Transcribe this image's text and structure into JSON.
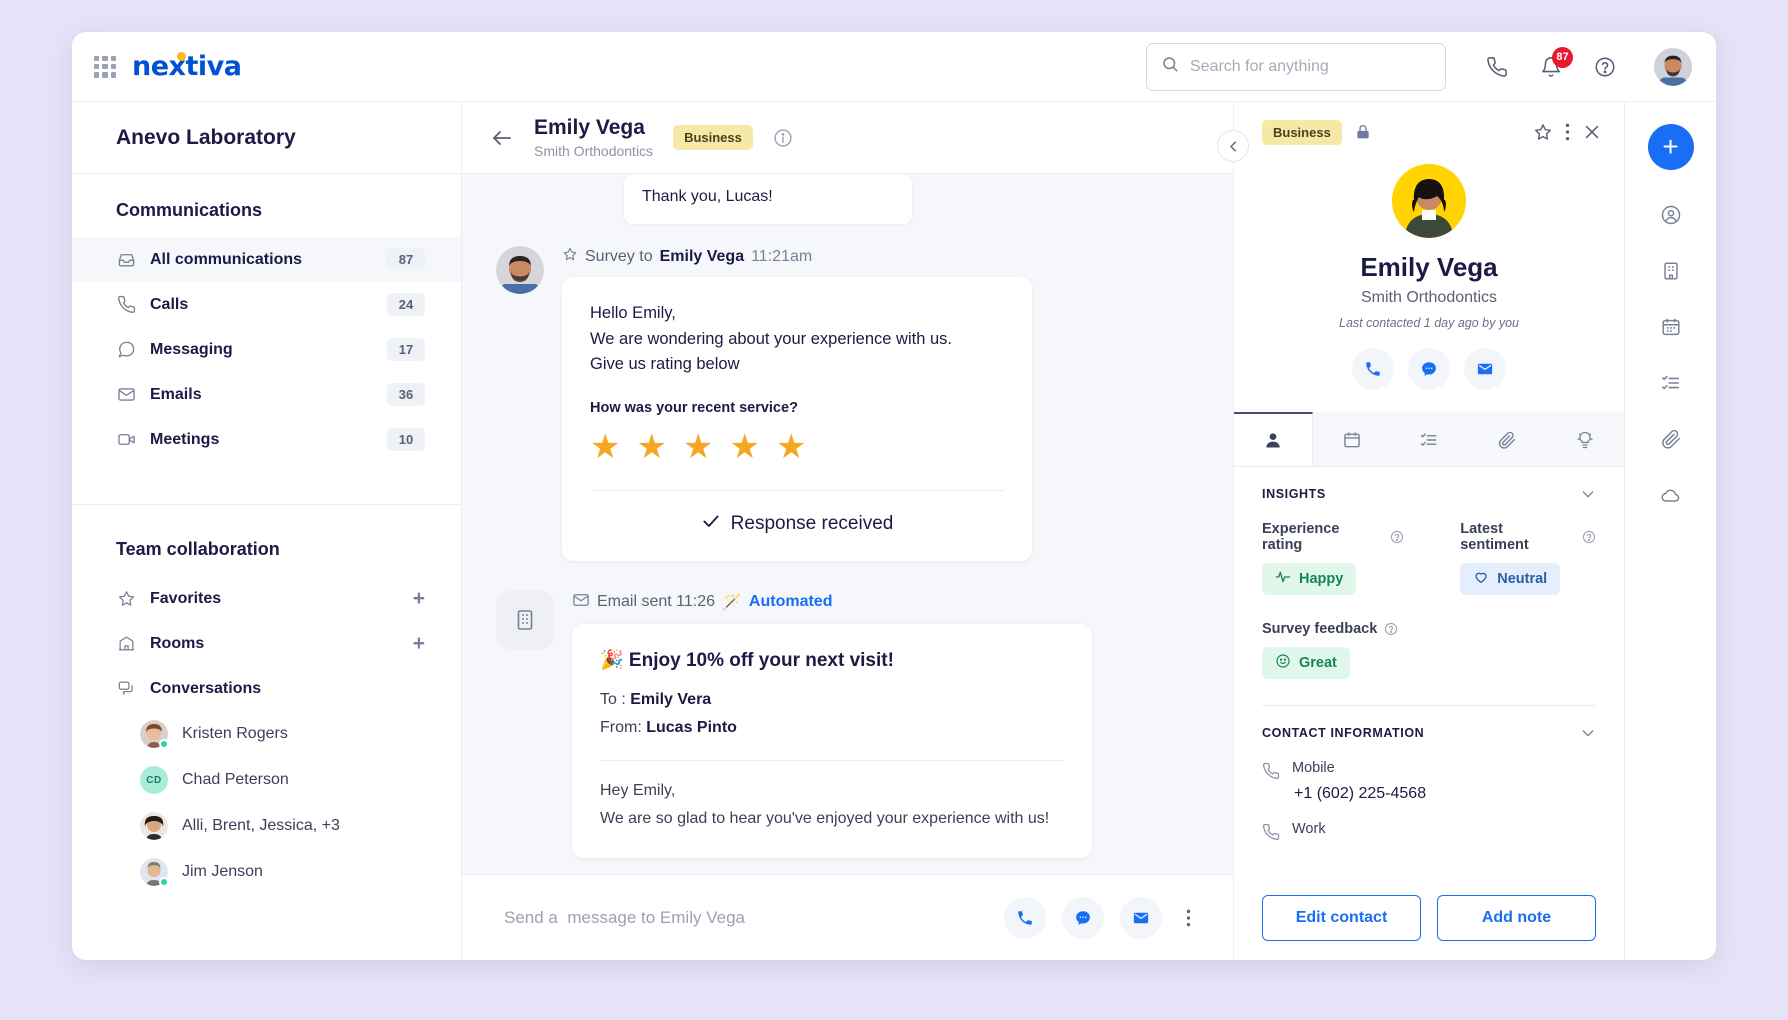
{
  "topbar": {
    "logo_text": "nextiva",
    "search_placeholder": "Search for anything",
    "notification_count": "87",
    "icons": [
      "grid-icon",
      "phone-icon",
      "bell-icon",
      "help-icon",
      "user-avatar"
    ]
  },
  "sidebar": {
    "workspace": "Anevo Laboratory",
    "communications_title": "Communications",
    "communications": [
      {
        "label": "All communications",
        "count": "87",
        "icon": "inbox-icon",
        "active": true
      },
      {
        "label": "Calls",
        "count": "24",
        "icon": "phone-icon",
        "active": false
      },
      {
        "label": "Messaging",
        "count": "17",
        "icon": "chat-icon",
        "active": false
      },
      {
        "label": "Emails",
        "count": "36",
        "icon": "envelope-icon",
        "active": false
      },
      {
        "label": "Meetings",
        "count": "10",
        "icon": "video-icon",
        "active": false
      }
    ],
    "team_title": "Team collaboration",
    "team": [
      {
        "label": "Favorites",
        "icon": "star-icon",
        "action": "+"
      },
      {
        "label": "Rooms",
        "icon": "building-icon",
        "action": "+"
      },
      {
        "label": "Conversations",
        "icon": "conversations-icon",
        "action": ""
      }
    ],
    "conversations": [
      {
        "name": "Kristen Rogers",
        "online": true,
        "type": "photo"
      },
      {
        "name": "Chad Peterson",
        "online": false,
        "type": "initials",
        "initials": "CD"
      },
      {
        "name": "Alli, Brent, Jessica, +3",
        "online": false,
        "type": "photo"
      },
      {
        "name": "Jim Jenson",
        "online": true,
        "type": "photo"
      }
    ]
  },
  "conversation": {
    "contact_name": "Emily Vega",
    "contact_org": "Smith Orthodontics",
    "tag": "Business",
    "previous_message": "Thank you, Lucas!",
    "survey": {
      "label": "Survey to",
      "recipient": "Emily Vega",
      "time": "11:21am",
      "greeting": "Hello Emily,",
      "line2": "We are wondering about your experience with us.",
      "line3": "Give us rating below",
      "question": "How was your recent service?",
      "stars_filled": 5,
      "response_status": "Response received"
    },
    "email": {
      "meta": "Email sent 11:26",
      "automated_label": "Automated",
      "subject": "🎉 Enjoy 10% off your next visit!",
      "to_label": "To :",
      "to_value": "Emily Vera",
      "from_label": "From:",
      "from_value": "Lucas Pinto",
      "body_line1": "Hey Emily,",
      "body_line2": "We are so glad to hear you've enjoyed your experience with us!"
    },
    "composer_placeholder": "Send a  message to Emily Vega",
    "composer_actions": [
      "call-icon",
      "message-icon",
      "email-icon",
      "more-icon"
    ]
  },
  "contact_panel": {
    "tag": "Business",
    "name": "Emily Vega",
    "org": "Smith Orthodontics",
    "last_contacted": "Last contacted 1 day ago by you",
    "quick_actions": [
      "call-icon",
      "message-icon",
      "email-icon"
    ],
    "tabs": [
      "person-icon",
      "calendar-icon",
      "tasks-icon",
      "attachment-icon",
      "insights-icon"
    ],
    "insights": {
      "section_title": "INSIGHTS",
      "experience_label": "Experience rating",
      "experience_value": "Happy",
      "sentiment_label": "Latest sentiment",
      "sentiment_value": "Neutral",
      "survey_label": "Survey feedback",
      "survey_value": "Great"
    },
    "contact_information": {
      "section_title": "CONTACT INFORMATION",
      "rows": [
        {
          "label": "Mobile",
          "value": "+1 (602) 225-4568"
        },
        {
          "label": "Work",
          "value": ""
        }
      ]
    },
    "footer": {
      "edit": "Edit contact",
      "add_note": "Add note"
    }
  },
  "rail": {
    "add_label": "+",
    "icons": [
      "person-icon",
      "building-icon",
      "calendar-icon",
      "tasks-icon",
      "attachment-icon",
      "cloud-icon"
    ]
  },
  "colors": {
    "brand_blue": "#1a6ef5",
    "logo_blue": "#0052d4",
    "accent_yellow": "#ffb81c",
    "badge_red": "#e8192c",
    "star_orange": "#f5a623",
    "green": "#14865c",
    "page_bg": "#e6e3f8"
  }
}
